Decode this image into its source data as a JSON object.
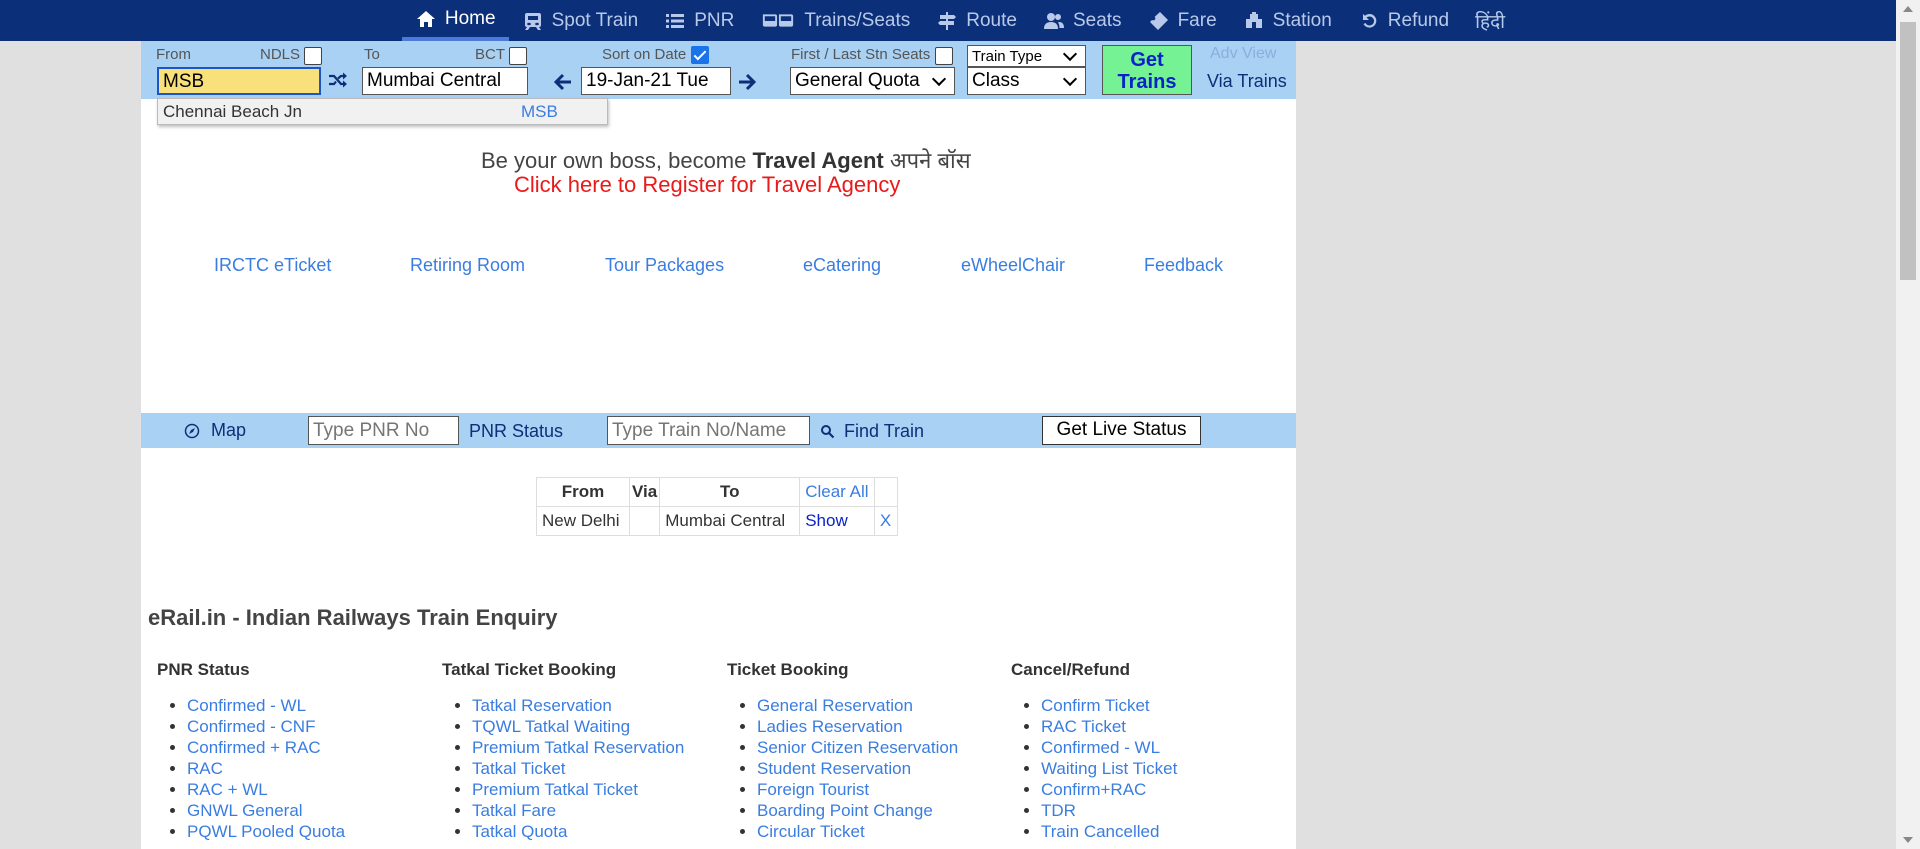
{
  "nav": {
    "items": [
      {
        "label": "Home",
        "icon": "home-icon"
      },
      {
        "label": "Spot Train",
        "icon": "train-icon"
      },
      {
        "label": "PNR",
        "icon": "list-icon"
      },
      {
        "label": "Trains/Seats",
        "icon": "trains-icon"
      },
      {
        "label": "Route",
        "icon": "signpost-icon"
      },
      {
        "label": "Seats",
        "icon": "users-icon"
      },
      {
        "label": "Fare",
        "icon": "ticket-icon"
      },
      {
        "label": "Station",
        "icon": "station-icon"
      },
      {
        "label": "Refund",
        "icon": "undo-icon"
      },
      {
        "label": "हिंदी",
        "icon": ""
      }
    ],
    "active": "Home"
  },
  "search": {
    "from_label": "From",
    "from_hint": "NDLS",
    "from_value": "MSB",
    "to_label": "To",
    "to_hint": "BCT",
    "to_value": "Mumbai Central",
    "sort_label": "Sort on Date",
    "sort_checked": true,
    "date_value": "19-Jan-21 Tue",
    "first_last_label": "First / Last Stn Seats",
    "quota_value": "General Quota",
    "train_type_value": "Train Type",
    "class_value": "Class",
    "get_trains_label": "Get Trains",
    "adv_view_label": "Adv View",
    "via_trains_label": "Via Trains"
  },
  "suggestion": {
    "name": "Chennai Beach Jn",
    "code": "MSB"
  },
  "promo": {
    "line1_pre": "Be your own boss, become ",
    "line1_bold": "Travel Agent",
    "line1_post": " अपने बॉस ",
    "line2": "Click here to Register for Travel Agency"
  },
  "quick_links": [
    "IRCTC eTicket",
    "Retiring Room",
    "Tour Packages",
    "eCatering",
    "eWheelChair",
    "Feedback"
  ],
  "pnr_bar": {
    "map_label": "Map",
    "pnr_placeholder": "Type PNR No",
    "pnr_status_label": "PNR Status",
    "train_placeholder": "Type Train No/Name",
    "find_train_label": "Find Train",
    "live_status_label": "Get Live Status"
  },
  "history": {
    "headers": [
      "From",
      "Via",
      "To",
      "Clear All"
    ],
    "rows": [
      {
        "from": "New Delhi",
        "via": "",
        "to": "Mumbai Central",
        "show": "Show",
        "remove": "X"
      }
    ]
  },
  "info": {
    "heading": "eRail.in - Indian Railways Train Enquiry",
    "columns": [
      {
        "title": "PNR Status",
        "items": [
          "Confirmed - WL",
          "Confirmed - CNF",
          "Confirmed + RAC",
          "RAC",
          "RAC + WL",
          "GNWL General",
          "PQWL Pooled Quota"
        ]
      },
      {
        "title": "Tatkal Ticket Booking",
        "items": [
          "Tatkal Reservation",
          "TQWL Tatkal Waiting",
          "Premium Tatkal Reservation",
          "Tatkal Ticket",
          "Premium Tatkal Ticket",
          "Tatkal Fare",
          "Tatkal Quota"
        ]
      },
      {
        "title": "Ticket Booking",
        "items": [
          "General Reservation",
          "Ladies Reservation",
          "Senior Citizen Reservation",
          "Student Reservation",
          "Foreign Tourist",
          "Boarding Point Change",
          "Circular Ticket"
        ]
      },
      {
        "title": "Cancel/Refund",
        "items": [
          "Confirm Ticket",
          "RAC Ticket",
          "Confirmed - WL",
          "Waiting List Ticket",
          "Confirm+RAC",
          "TDR",
          "Train Cancelled"
        ]
      }
    ]
  },
  "colors": {
    "nav_bg": "#0b3079",
    "bar_bg": "#a9d1f4",
    "link": "#3a7de0",
    "get_btn": "#74f294",
    "highlight": "#f8e07a",
    "promo_red": "#e81a1a"
  }
}
